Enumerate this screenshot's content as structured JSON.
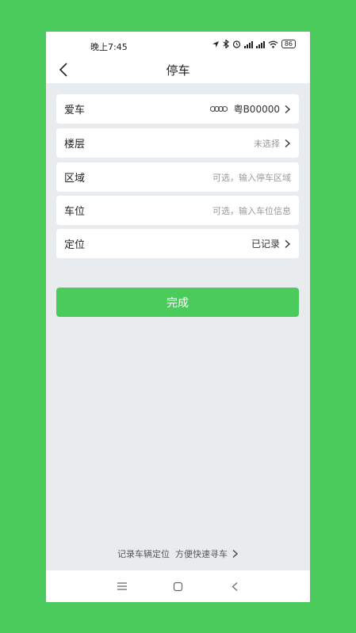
{
  "status": {
    "time": "晚上7:45",
    "battery": "86"
  },
  "header": {
    "title": "停车",
    "back_icon": "chevron-left-icon"
  },
  "form": {
    "car": {
      "label": "爱车",
      "value": "粤B00000",
      "logo_icon": "audi-logo-icon"
    },
    "floor": {
      "label": "楼层",
      "value": "未选择"
    },
    "area": {
      "label": "区域",
      "placeholder": "可选，输入停车区域"
    },
    "spot": {
      "label": "车位",
      "placeholder": "可选，输入车位信息"
    },
    "location": {
      "label": "定位",
      "value": "已记录"
    }
  },
  "actions": {
    "done_label": "完成"
  },
  "footer": {
    "link_text": "记录车辆定位  方便快速寻车"
  },
  "colors": {
    "accent": "#4ccb5d",
    "background": "#e9ecee",
    "card": "#ffffff"
  }
}
